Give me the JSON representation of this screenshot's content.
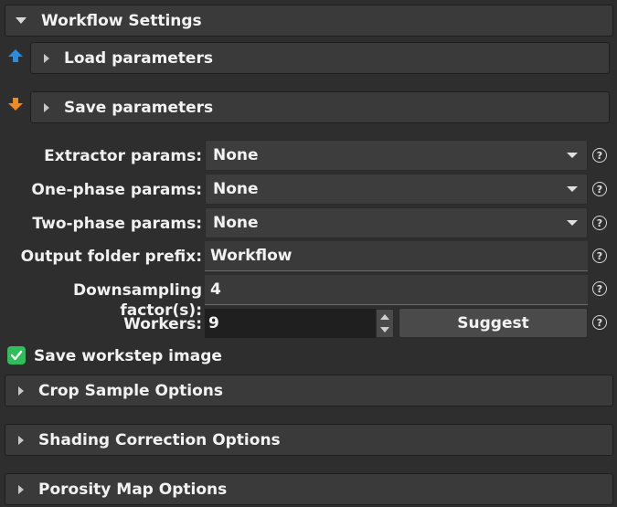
{
  "workflow_settings": {
    "title": "Workflow Settings"
  },
  "load_parameters": {
    "title": "Load parameters"
  },
  "save_parameters": {
    "title": "Save parameters"
  },
  "form": {
    "extractor_params": {
      "label": "Extractor params:",
      "value": "None"
    },
    "one_phase_params": {
      "label": "One-phase params:",
      "value": "None"
    },
    "two_phase_params": {
      "label": "Two-phase params:",
      "value": "None"
    },
    "output_folder_prefix": {
      "label": "Output folder prefix:",
      "value": "Workflow"
    },
    "downsampling": {
      "label": "Downsampling factor(s):",
      "value": "4"
    },
    "workers": {
      "label": "Workers:",
      "value": "9",
      "suggest_label": "Suggest"
    },
    "help_glyph": "?"
  },
  "save_workstep_image": {
    "label": "Save workstep image",
    "checked": true
  },
  "sections": {
    "crop": "Crop Sample Options",
    "shading": "Shading Correction Options",
    "porosity": "Porosity Map Options"
  },
  "colors": {
    "accent_green": "#2fbf5a",
    "load_arrow": "#2b8de0",
    "save_arrow": "#f08a1c"
  }
}
